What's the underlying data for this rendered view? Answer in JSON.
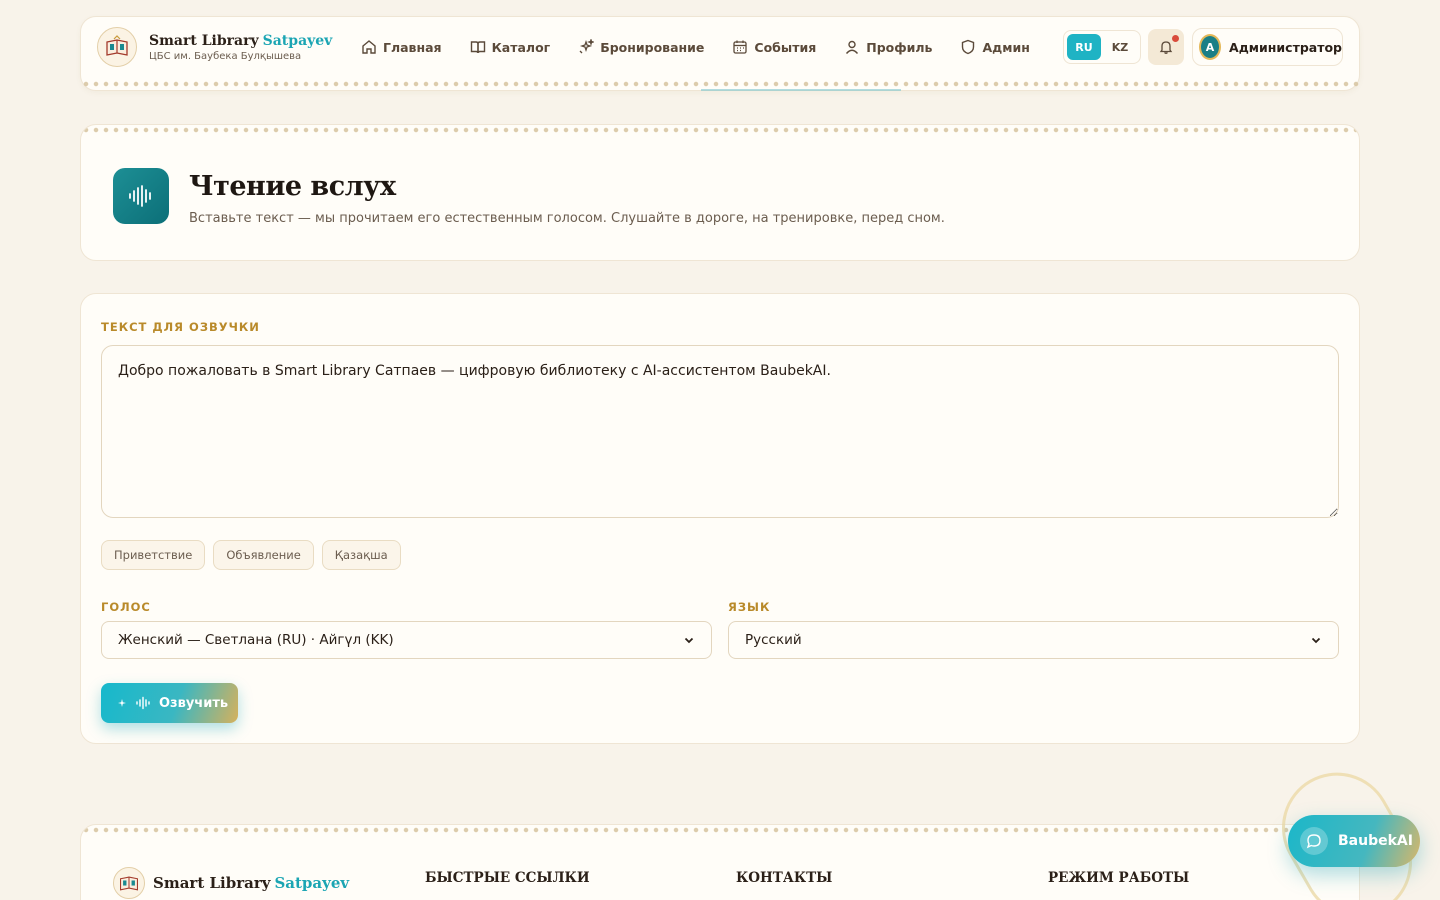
{
  "header": {
    "brand_name": "Smart Library",
    "brand_accent": "Satpayev",
    "brand_sub": "ЦБС им. Баубека Булқышева",
    "nav": [
      {
        "label": "Главная",
        "icon": "home-icon"
      },
      {
        "label": "Каталог",
        "icon": "book-icon"
      },
      {
        "label": "Бронирование",
        "icon": "sparkles-icon"
      },
      {
        "label": "События",
        "icon": "calendar-icon"
      },
      {
        "label": "Профиль",
        "icon": "user-icon"
      },
      {
        "label": "Админ",
        "icon": "shield-icon"
      }
    ],
    "lang_ru": "RU",
    "lang_kz": "KZ",
    "active_lang": "RU",
    "user_initial": "A",
    "user_name": "Администратор"
  },
  "page": {
    "title": "Чтение вслух",
    "subtitle": "Вставьте текст — мы прочитаем его естественным голосом. Слушайте в дороге, на тренировке, перед сном."
  },
  "form": {
    "text_label": "ТЕКСТ ДЛЯ ОЗВУЧКИ",
    "text_value": "Добро пожаловать в Smart Library Сатпаев — цифровую библиотеку с AI-ассистентом BaubekAI.",
    "presets": [
      "Приветствие",
      "Объявление",
      "Қазақша"
    ],
    "voice_label": "ГОЛОС",
    "voice_value": "Женский — Светлана (RU) · Айгүл (KK)",
    "language_label": "ЯЗЫК",
    "language_value": "Русский",
    "speak_button": "Озвучить"
  },
  "footer": {
    "brand_name": "Smart Library",
    "brand_accent": "Satpayev",
    "col1": "БЫСТРЫЕ ССЫЛКИ",
    "col2": "КОНТАКТЫ",
    "col3": "РЕЖИМ РАБОТЫ"
  },
  "assistant": {
    "label": "BaubekAI"
  },
  "colors": {
    "accent_teal": "#1fb3c4",
    "accent_gold": "#b98a2a",
    "background": "#f8f3ea"
  }
}
